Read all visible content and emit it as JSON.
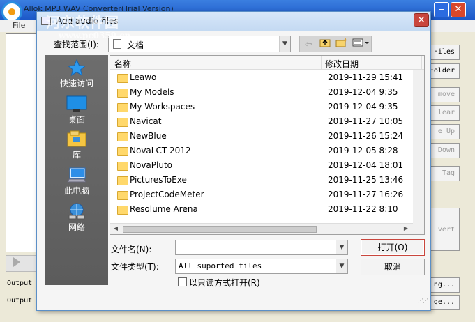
{
  "background_app": {
    "title": "Allok MP3 WAV Converter(Trial Version)",
    "menu_file": "File",
    "watermark_text": "河东软件园",
    "watermark_url": "www.pc0359.cn",
    "side_buttons": [
      "Files",
      "Folder",
      "move",
      "lear",
      "e Up",
      "Down",
      "Tag"
    ],
    "convert_label": "vert",
    "output_labels": [
      "Output",
      "Output"
    ],
    "output_buttons": [
      "ng...",
      "ge..."
    ]
  },
  "dialog": {
    "title": "Add audio files",
    "close_symbol": "✕",
    "look_in_label": "查找范围(I):",
    "look_in_value": "文档",
    "places": [
      {
        "label": "快速访问",
        "icon": "star-icon"
      },
      {
        "label": "桌面",
        "icon": "desktop-icon"
      },
      {
        "label": "库",
        "icon": "library-icon"
      },
      {
        "label": "此电脑",
        "icon": "computer-icon"
      },
      {
        "label": "网络",
        "icon": "network-icon"
      }
    ],
    "columns": {
      "name": "名称",
      "date": "修改日期"
    },
    "files": [
      {
        "name": "Leawo",
        "date": "2019-11-29 15:41"
      },
      {
        "name": "My Models",
        "date": "2019-12-04 9:35"
      },
      {
        "name": "My Workspaces",
        "date": "2019-12-04 9:35"
      },
      {
        "name": "Navicat",
        "date": "2019-11-27 10:05"
      },
      {
        "name": "NewBlue",
        "date": "2019-11-26 15:24"
      },
      {
        "name": "NovaLCT 2012",
        "date": "2019-12-05 8:28"
      },
      {
        "name": "NovaPluto",
        "date": "2019-12-04 18:01"
      },
      {
        "name": "PicturesToExe",
        "date": "2019-11-25 13:46"
      },
      {
        "name": "ProjectCodeMeter",
        "date": "2019-11-27 16:26"
      },
      {
        "name": "Resolume Arena",
        "date": "2019-11-22 8:10"
      }
    ],
    "filename_label": "文件名(N):",
    "filename_value": "",
    "filetype_label": "文件类型(T):",
    "filetype_value": "All suported files",
    "open_label": "打开(O)",
    "cancel_label": "取消",
    "readonly_label": "以只读方式打开(R)",
    "readonly_checked": false
  },
  "colors": {
    "dialog_border": "#5b8fc7",
    "close_button": "#c9463d",
    "places_bg": "#646464",
    "folder": "#ffd86b"
  }
}
